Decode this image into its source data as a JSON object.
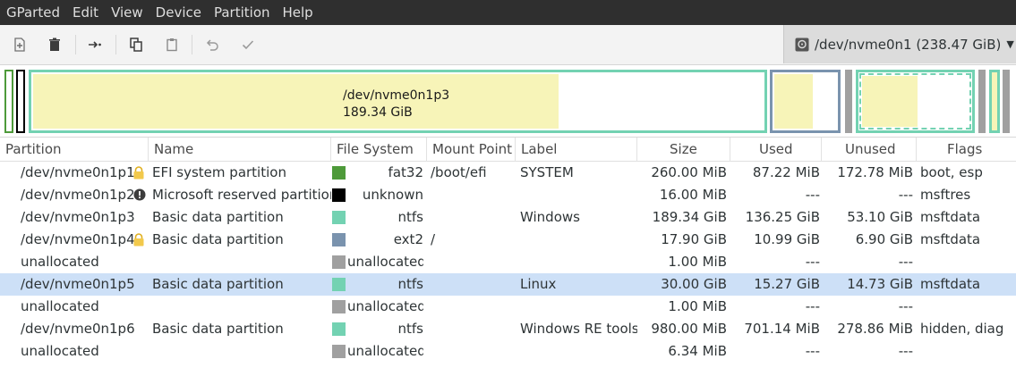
{
  "menu": [
    "GParted",
    "Edit",
    "View",
    "Device",
    "Partition",
    "Help"
  ],
  "toolbar": {
    "icons": [
      "new-partition-icon",
      "delete-icon",
      "resize-move-icon",
      "copy-icon",
      "paste-icon",
      "undo-icon",
      "apply-icon"
    ]
  },
  "device": {
    "label": "/dev/nvme0n1 (238.47 GiB)"
  },
  "diskmap": {
    "selected_name": "/dev/nvme0n1p3",
    "selected_size": "189.34 GiB"
  },
  "colors": {
    "fat32": "#4e9a3a",
    "unknown": "#000000",
    "ntfs": "#73d2b2",
    "ext2": "#7a93ae",
    "unallocated": "#a0a0a0",
    "used_fill": "#f7f4b8",
    "selection": "#cde0f7"
  },
  "table": {
    "headers": {
      "partition": "Partition",
      "name": "Name",
      "filesystem": "File System",
      "mountpoint": "Mount Point",
      "label": "Label",
      "size": "Size",
      "used": "Used",
      "unused": "Unused",
      "flags": "Flags"
    },
    "rows": [
      {
        "partition": "/dev/nvme0n1p1",
        "name": "EFI system partition",
        "fs": "fat32",
        "fs_color": "fat32",
        "mount": "/boot/efi",
        "label": "SYSTEM",
        "size": "260.00 MiB",
        "used": "87.22 MiB",
        "unused": "172.78 MiB",
        "flags": "boot, esp",
        "icon": "lock"
      },
      {
        "partition": "/dev/nvme0n1p2",
        "name": "Microsoft reserved partition",
        "fs": "unknown",
        "fs_color": "unknown",
        "mount": "",
        "label": "",
        "size": "16.00 MiB",
        "used": "---",
        "unused": "---",
        "flags": "msftres",
        "icon": "warning"
      },
      {
        "partition": "/dev/nvme0n1p3",
        "name": "Basic data partition",
        "fs": "ntfs",
        "fs_color": "ntfs",
        "mount": "",
        "label": "Windows",
        "size": "189.34 GiB",
        "used": "136.25 GiB",
        "unused": "53.10 GiB",
        "flags": "msftdata",
        "icon": ""
      },
      {
        "partition": "/dev/nvme0n1p4",
        "name": "Basic data partition",
        "fs": "ext2",
        "fs_color": "ext2",
        "mount": "/",
        "label": "",
        "size": "17.90 GiB",
        "used": "10.99 GiB",
        "unused": "6.90 GiB",
        "flags": "msftdata",
        "icon": "lock"
      },
      {
        "partition": "unallocated",
        "name": "",
        "fs": "unallocated",
        "fs_color": "unallocated",
        "mount": "",
        "label": "",
        "size": "1.00 MiB",
        "used": "---",
        "unused": "---",
        "flags": "",
        "icon": ""
      },
      {
        "partition": "/dev/nvme0n1p5",
        "name": "Basic data partition",
        "fs": "ntfs",
        "fs_color": "ntfs",
        "mount": "",
        "label": "Linux",
        "size": "30.00 GiB",
        "used": "15.27 GiB",
        "unused": "14.73 GiB",
        "flags": "msftdata",
        "icon": "",
        "selected": true
      },
      {
        "partition": "unallocated",
        "name": "",
        "fs": "unallocated",
        "fs_color": "unallocated",
        "mount": "",
        "label": "",
        "size": "1.00 MiB",
        "used": "---",
        "unused": "---",
        "flags": "",
        "icon": ""
      },
      {
        "partition": "/dev/nvme0n1p6",
        "name": "Basic data partition",
        "fs": "ntfs",
        "fs_color": "ntfs",
        "mount": "",
        "label": "Windows RE tools",
        "size": "980.00 MiB",
        "used": "701.14 MiB",
        "unused": "278.86 MiB",
        "flags": "hidden, diag",
        "icon": ""
      },
      {
        "partition": "unallocated",
        "name": "",
        "fs": "unallocated",
        "fs_color": "unallocated",
        "mount": "",
        "label": "",
        "size": "6.34 MiB",
        "used": "---",
        "unused": "---",
        "flags": "",
        "icon": ""
      }
    ]
  }
}
